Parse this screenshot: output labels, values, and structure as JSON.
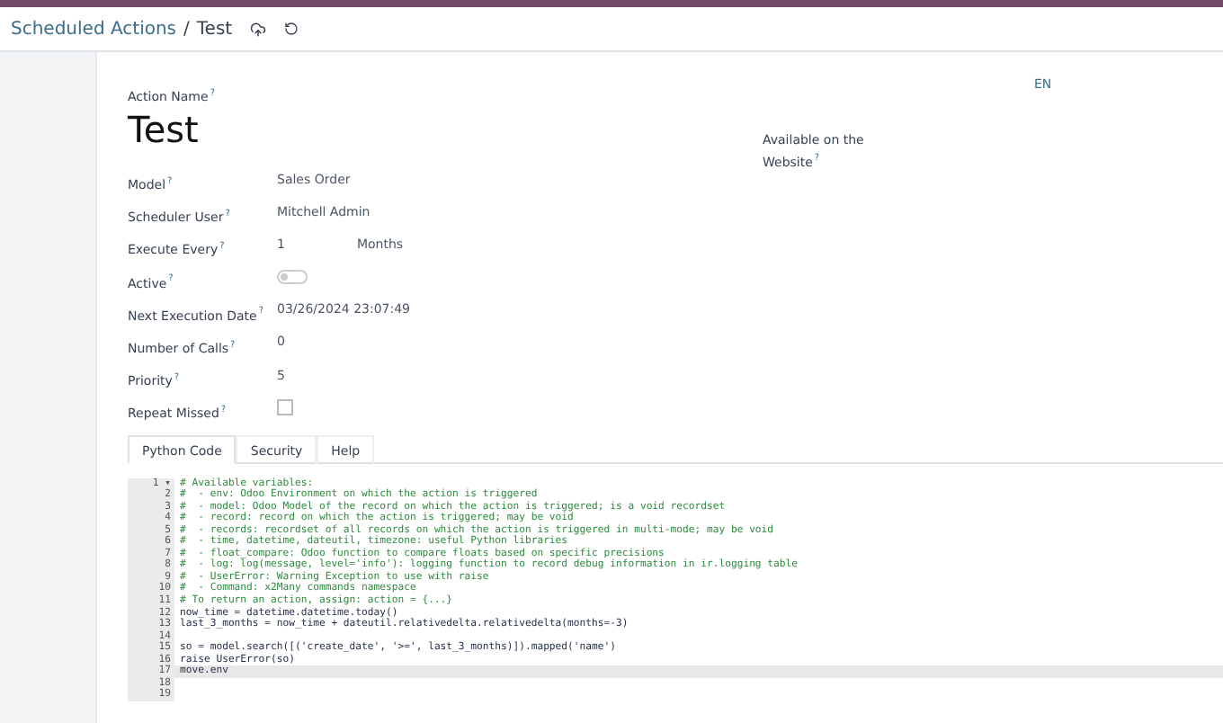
{
  "breadcrumb": {
    "parent": "Scheduled Actions",
    "separator": "/",
    "current": "Test"
  },
  "form": {
    "name_label": "Action Name",
    "name_help": "?",
    "name": "Test",
    "language": "EN",
    "fields": [
      {
        "kind": "text",
        "label": "Model",
        "help": "?",
        "value": "Sales Order"
      },
      {
        "kind": "text",
        "label": "Scheduler User",
        "help": "?",
        "value": "Mitchell Admin"
      },
      {
        "kind": "interval",
        "label": "Execute Every",
        "help": "?",
        "value": "1",
        "unit": "Months"
      },
      {
        "kind": "toggle",
        "label": "Active",
        "help": "?",
        "on": false
      },
      {
        "kind": "text",
        "label": "Next Execution Date",
        "help": "?",
        "value": "03/26/2024 23:07:49"
      },
      {
        "kind": "text",
        "label": "Number of Calls",
        "help": "?",
        "value": "0"
      },
      {
        "kind": "text",
        "label": "Priority",
        "help": "?",
        "value": "5"
      },
      {
        "kind": "checkbox",
        "label": "Repeat Missed",
        "help": "?",
        "checked": false
      }
    ],
    "right_fields": [
      {
        "label": "Available on the Website",
        "help": "?"
      }
    ]
  },
  "tabs": [
    {
      "label": "Python Code",
      "selected": true
    },
    {
      "label": "Security",
      "selected": false
    },
    {
      "label": "Help",
      "selected": false
    }
  ],
  "code": {
    "fold_marker": "▾",
    "lines": [
      {
        "number": "1",
        "kind": "comment",
        "text": "# Available variables:",
        "current": false
      },
      {
        "number": "2",
        "kind": "comment",
        "text": "#  - env: Odoo Environment on which the action is triggered",
        "current": false
      },
      {
        "number": "3",
        "kind": "comment",
        "text": "#  - model: Odoo Model of the record on which the action is triggered; is a void recordset",
        "current": false
      },
      {
        "number": "4",
        "kind": "comment",
        "text": "#  - record: record on which the action is triggered; may be void",
        "current": false
      },
      {
        "number": "5",
        "kind": "comment",
        "text": "#  - records: recordset of all records on which the action is triggered in multi-mode; may be void",
        "current": false
      },
      {
        "number": "6",
        "kind": "comment",
        "text": "#  - time, datetime, dateutil, timezone: useful Python libraries",
        "current": false
      },
      {
        "number": "7",
        "kind": "comment",
        "text": "#  - float_compare: Odoo function to compare floats based on specific precisions",
        "current": false
      },
      {
        "number": "8",
        "kind": "comment",
        "text": "#  - log: log(message, level='info'): logging function to record debug information in ir.logging table",
        "current": false
      },
      {
        "number": "9",
        "kind": "comment",
        "text": "#  - UserError: Warning Exception to use with raise",
        "current": false
      },
      {
        "number": "10",
        "kind": "comment",
        "text": "#  - Command: x2Many commands namespace",
        "current": false
      },
      {
        "number": "11",
        "kind": "comment",
        "text": "# To return an action, assign: action = {...}",
        "current": false
      },
      {
        "number": "12",
        "kind": "code",
        "text": "now_time = datetime.datetime.today()",
        "current": false
      },
      {
        "number": "13",
        "kind": "code",
        "text": "last_3_months = now_time + dateutil.relativedelta.relativedelta(months=-3)",
        "current": false
      },
      {
        "number": "14",
        "current": false
      },
      {
        "number": "15",
        "kind": "code",
        "text": "so = model.search([('create_date', '>=', last_3_months)]).mapped('name')",
        "current": false
      },
      {
        "number": "16",
        "kind": "code",
        "text": "raise UserError(so)",
        "current": false
      },
      {
        "number": "17",
        "kind": "code",
        "text": "move.env",
        "current": true
      },
      {
        "number": "18",
        "current": false
      },
      {
        "number": "19",
        "current": false
      }
    ]
  }
}
